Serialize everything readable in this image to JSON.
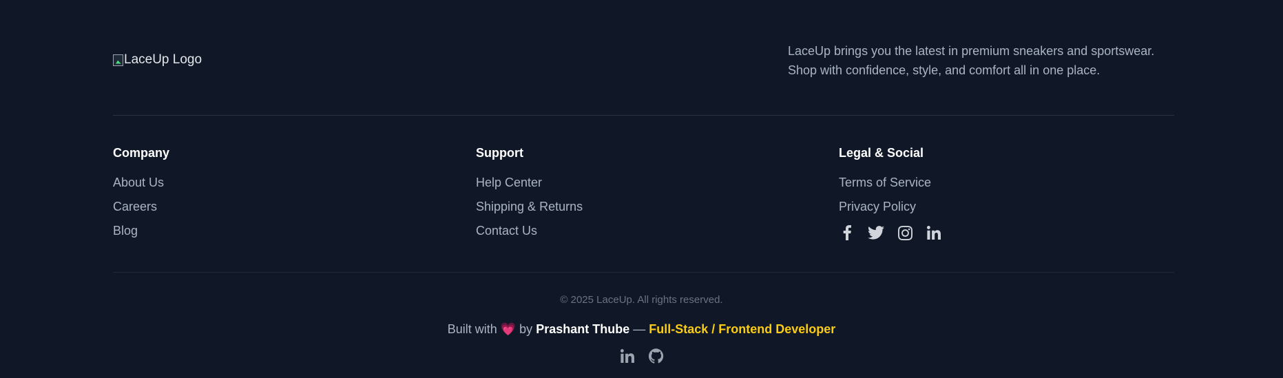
{
  "brand": {
    "logo_alt": "LaceUp Logo",
    "tagline": "LaceUp brings you the latest in premium sneakers and sportswear. Shop with confidence, style, and comfort all in one place."
  },
  "columns": {
    "company": {
      "heading": "Company",
      "links": [
        "About Us",
        "Careers",
        "Blog"
      ]
    },
    "support": {
      "heading": "Support",
      "links": [
        "Help Center",
        "Shipping & Returns",
        "Contact Us"
      ]
    },
    "legal": {
      "heading": "Legal & Social",
      "links": [
        "Terms of Service",
        "Privacy Policy"
      ],
      "social_icons": [
        "facebook-icon",
        "twitter-icon",
        "instagram-icon",
        "linkedin-icon"
      ]
    }
  },
  "bottom": {
    "copyright": "© 2025 LaceUp. All rights reserved.",
    "built_prefix": "Built with",
    "heart": "💗",
    "by": "by",
    "author": "Prashant Thube",
    "dash": "—",
    "role": "Full-Stack / Frontend Developer",
    "author_icons": [
      "linkedin-icon",
      "github-icon"
    ]
  },
  "colors": {
    "background": "#101828",
    "heading": "#ffffff",
    "link": "#aab4c3",
    "accent": "#facc15",
    "heart": "#f43f73"
  }
}
